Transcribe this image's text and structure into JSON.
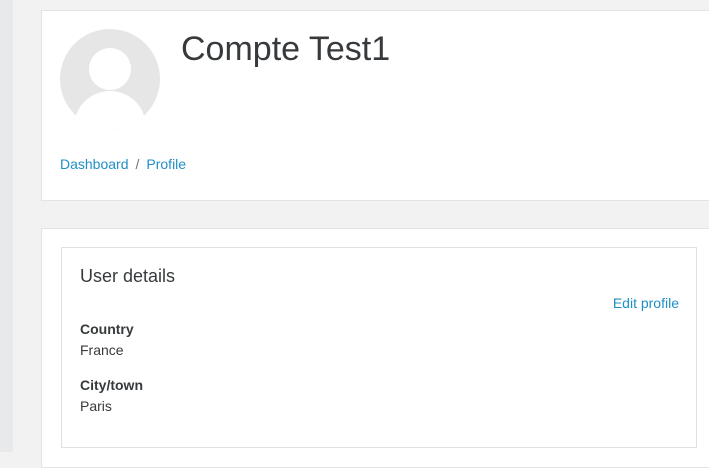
{
  "header": {
    "title": "Compte Test1",
    "breadcrumb": {
      "items": [
        "Dashboard",
        "Profile"
      ],
      "separator": "/"
    }
  },
  "user_details": {
    "title": "User details",
    "edit_label": "Edit profile",
    "fields": [
      {
        "label": "Country",
        "value": "France"
      },
      {
        "label": "City/town",
        "value": "Paris"
      }
    ]
  },
  "icons": {
    "avatar": "default-user-avatar-icon"
  },
  "colors": {
    "link": "#1f8fc6",
    "text": "#373a3c",
    "page_bg": "#f2f2f2",
    "card_bg": "#ffffff",
    "avatar_bg": "#e6e6e6"
  }
}
